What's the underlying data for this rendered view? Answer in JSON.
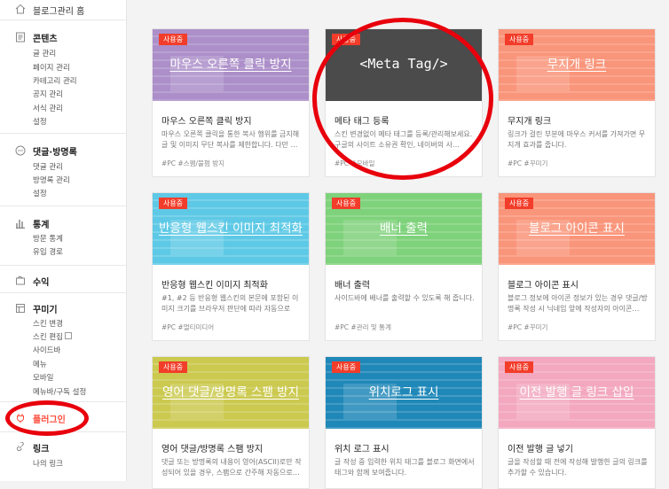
{
  "sidebar": {
    "home": "블로그관리 홈",
    "sections": [
      {
        "title": "콘텐츠",
        "items": [
          "글 관리",
          "페이지 관리",
          "카테고리 관리",
          "공지 관리",
          "서식 관리",
          "설정"
        ]
      },
      {
        "title": "댓글·방명록",
        "items": [
          "댓글 관리",
          "방명록 관리",
          "설정"
        ]
      },
      {
        "title": "통계",
        "items": [
          "방문 통계",
          "유입 경로"
        ]
      },
      {
        "title": "수익",
        "items": []
      },
      {
        "title": "꾸미기",
        "items": [
          "스킨 변경",
          "스킨 편집",
          "사이드바",
          "메뉴",
          "모바일",
          "메뉴바/구독 설정"
        ]
      },
      {
        "title": "플러그인",
        "items": []
      },
      {
        "title": "링크",
        "items": [
          "나의 링크"
        ]
      }
    ]
  },
  "badge_label": "사용중",
  "cards": [
    {
      "thumb_title": "마우스 오른쪽 클릭 방지",
      "name": "마우스 오른쪽 클릭 방지",
      "desc": "마우스 오른쪽 클릭을 통한 복사 행위를 금지해 글 및 이미지 무단 복사를 제한합니다. 다만 …",
      "tags": "#PC  #스팸/불펌 방지",
      "color": "#ac8fc9"
    },
    {
      "thumb_title": "<Meta Tag/>",
      "name": "메타 태그 등록",
      "desc": "스킨 변경없이 메타 태그를 등록/관리해보세요. 구글의 사이트 소유권 확인, 네이버의 사…",
      "tags": "#PC  #모바일",
      "color": "#4b4b4b"
    },
    {
      "thumb_title": "무지개 링크",
      "name": "무지개 링크",
      "desc": "링크가 걸린 부분에 마우스 커서를 가져가면 무지개 효과를 줍니다.",
      "tags": "#PC  #꾸미기",
      "color": "#f9957a"
    },
    {
      "thumb_title": "반응형 웹스킨 이미지 최적화",
      "name": "반응형 웹스킨 이미지 최적화",
      "desc": "#1, #2 등 반응형 웹스킨의 본문에 포함된 이미지 크기를 브라우저 판단에 따라 자동으로 조…",
      "tags": "#PC  #멀티미디어",
      "color": "#5ec9e6"
    },
    {
      "thumb_title": "배너 출력",
      "name": "배너 출력",
      "desc": "사이드바에 배너를 출력할 수 있도록 해 줍니다.",
      "tags": "#PC  #관리 및 통계",
      "color": "#7ed27b"
    },
    {
      "thumb_title": "블로그 아이콘 표시",
      "name": "블로그 아이콘 표시",
      "desc": "블로그 정보에 아이콘 정보가 있는 경우 댓글/방명록 작성 시 닉네임 앞에 작성자의 아이콘…",
      "tags": "#PC  #꾸미기",
      "color": "#f9957a"
    },
    {
      "thumb_title": "영어 댓글/방명록 스팸 방지",
      "name": "영어 댓글/방명록 스팸 방지",
      "desc": "댓글 또는 방명록의 내용이 영어(ASCII)로만 작성되어 있을 경우, 스팸으로 간주해 자동으로…",
      "tags": "",
      "color": "#cbc94f"
    },
    {
      "thumb_title": "위치로그 표시",
      "name": "위치 로그 표시",
      "desc": "글 작성 중 입력한 위치 태그를 블로그 화면에서 태그와 함께 보여줍니다.",
      "tags": "",
      "color": "#1f88b8"
    },
    {
      "thumb_title": "이전 발행 글 링크 삽입",
      "name": "이전 발행 글 넣기",
      "desc": "글을 작성할 때 전에 작성해 발행한 글의 링크를 추가할 수 있습니다.",
      "tags": "",
      "color": "#f3a8c0"
    }
  ]
}
